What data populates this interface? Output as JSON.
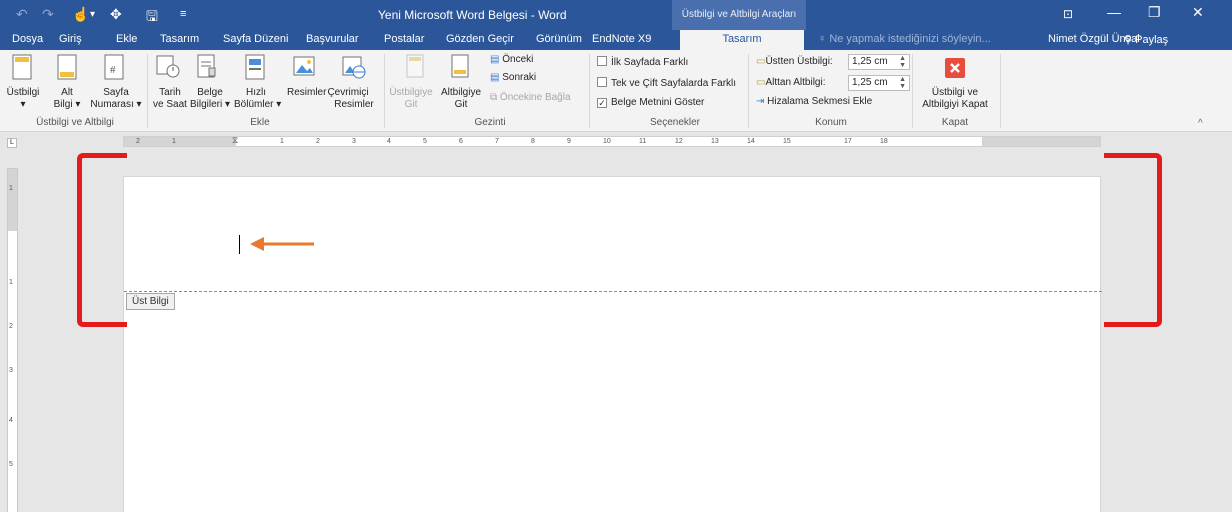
{
  "titlebar": {
    "title": "Yeni Microsoft Word Belgesi - Word",
    "contextual_title": "Üstbilgi ve Altbilgi Araçları",
    "qat": [
      "↶",
      "↷",
      "↻",
      "▾",
      "💾",
      "≡"
    ],
    "win_buttons": [
      "⊡",
      "—",
      "❐",
      "✕"
    ]
  },
  "tabs": [
    "Dosya",
    "Giriş",
    "Ekle",
    "Tasarım",
    "Sayfa Düzeni",
    "Başvurular",
    "Postalar",
    "Gözden Geçir",
    "Görünüm",
    "EndNote X9",
    "Tasarım"
  ],
  "tell_me": "Ne yapmak istediğinizi söyleyin...",
  "user_name": "Nimet Özgül Ünsal",
  "share": "Paylaş",
  "ribbon": {
    "header_footer": {
      "ustbilgi": "Üstbilgi",
      "alt": "Alt",
      "bilgi": "Bilgi ▾",
      "sayfa": "Sayfa",
      "numarasi": "Numarası ▾",
      "group": "Üstbilgi ve Altbilgi"
    },
    "insert": {
      "tarih": "Tarih",
      "ve_saat": "ve Saat",
      "belge": "Belge",
      "bilgileri": "Bilgileri ▾",
      "hizli": "Hızlı",
      "bolumler": "Bölümler ▾",
      "resimler": "Resimler",
      "cevrimici": "Çevrimiçi",
      "resimler2": "Resimler",
      "group": "Ekle"
    },
    "navigation": {
      "ustbilgiye": "Üstbilgiye",
      "git1": "Git",
      "altbilgiye": "Altbilgiye",
      "git2": "Git",
      "onceki": "Önceki",
      "sonraki": "Sonraki",
      "oncekine_bagla": "Öncekine Bağla",
      "group": "Gezinti"
    },
    "options": {
      "ilk_sayfa": "İlk Sayfada Farklı",
      "tek_cift": "Tek ve Çift Sayfalarda Farklı",
      "belge_metni": "Belge Metnini Göster",
      "group": "Seçenekler"
    },
    "position": {
      "ustten": "Üstten Üstbilgi:",
      "ustten_value": "1,25 cm",
      "alttan": "Alttan Altbilgi:",
      "alttan_value": "1,25 cm",
      "hizalama": "Hizalama Sekmesi Ekle",
      "group": "Konum"
    },
    "close": {
      "line1": "Üstbilgi ve",
      "line2": "Altbilgiyi Kapat",
      "group": "Kapat"
    }
  },
  "ruler_numbers": [
    "2",
    "1",
    "1",
    "2",
    "3",
    "4",
    "5",
    "6",
    "7",
    "8",
    "9",
    "10",
    "11",
    "12",
    "13",
    "14",
    "15",
    "17",
    "18"
  ],
  "vruler_numbers": [
    "1",
    "1",
    "2",
    "3",
    "4",
    "5"
  ],
  "tab_selector": "L",
  "document": {
    "header_tag": "Üst Bilgi"
  },
  "colors": {
    "word_blue": "#2b579a",
    "annotation_red": "#e31b1b",
    "arrow_orange": "#e87a2e",
    "close_red": "#e74c3c"
  }
}
